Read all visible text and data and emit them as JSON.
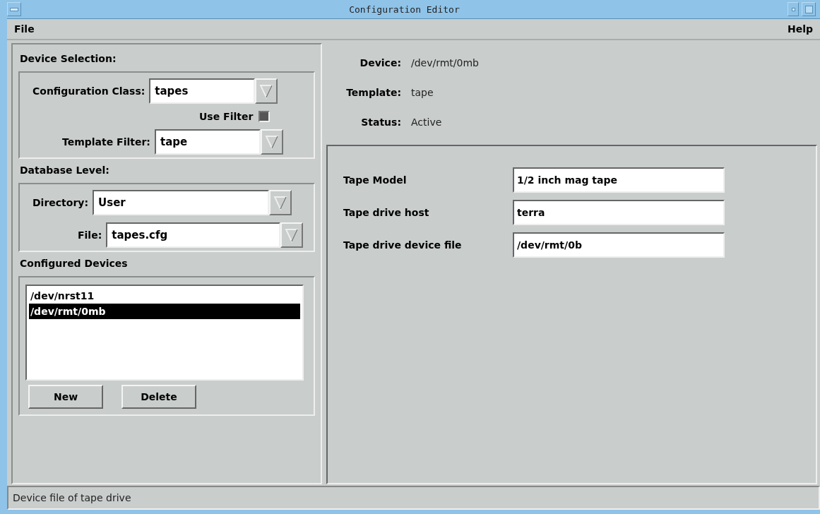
{
  "window": {
    "title": "Configuration Editor"
  },
  "menu": [
    {
      "label": "File"
    },
    {
      "label": "Help"
    }
  ],
  "device_selection": {
    "heading": "Device Selection:",
    "configuration_class": {
      "label": "Configuration Class:",
      "value": "tapes"
    },
    "use_filter": {
      "label": "Use Filter",
      "checked": true
    },
    "template_filter": {
      "label": "Template Filter:",
      "value": "tape"
    }
  },
  "database_level": {
    "heading": "Database Level:",
    "directory": {
      "label": "Directory:",
      "value": "User"
    },
    "file": {
      "label": "File:",
      "value": "tapes.cfg"
    }
  },
  "configured_devices": {
    "heading": "Configured Devices",
    "items": [
      {
        "label": "/dev/nrst11",
        "selected": false
      },
      {
        "label": "/dev/rmt/0mb",
        "selected": true
      }
    ],
    "buttons": [
      "New",
      "Delete"
    ]
  },
  "details": [
    {
      "label": "Device:",
      "value": "/dev/rmt/0mb"
    },
    {
      "label": "Template:",
      "value": "tape"
    },
    {
      "label": "Status:",
      "value": "Active"
    }
  ],
  "properties": [
    {
      "label": "Tape Model",
      "value": "1/2 inch mag tape"
    },
    {
      "label": "Tape drive host",
      "value": "terra"
    },
    {
      "label": "Tape drive device file",
      "value": "/dev/rmt/0b"
    }
  ],
  "status_bar": "Device file of tape drive"
}
